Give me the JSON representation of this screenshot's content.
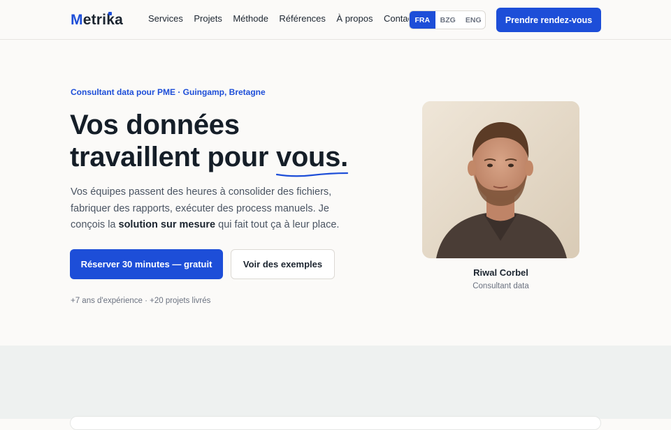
{
  "brand": {
    "name_parts": [
      "M",
      "etri",
      "k",
      "a"
    ]
  },
  "nav": {
    "items": [
      "Services",
      "Projets",
      "Méthode",
      "Références",
      "À propos",
      "Contact"
    ]
  },
  "languages": {
    "options": [
      "FRA",
      "BZG",
      "ENG"
    ],
    "selected": "FRA"
  },
  "header": {
    "cta_label": "Prendre rendez-vous"
  },
  "hero": {
    "eyebrow": "Consultant data pour PME · Guingamp, Bretagne",
    "headline_line1": "Vos données",
    "headline_line2_start": "travaillent pour ",
    "headline_highlight": "vous.",
    "description_part1": "Vos équipes passent des heures à consolider des fichiers, fabriquer des rapports, exécuter des process manuels. Je conçois la ",
    "description_bold": "solution sur mesure",
    "description_part2": " qui fait tout ça à leur place.",
    "primary_cta": "Réserver 30 minutes — gratuit",
    "secondary_cta": "Voir des exemples",
    "stats": "+7 ans d'expérience · +20 projets livrés"
  },
  "profile": {
    "name": "Riwal Corbel",
    "role": "Consultant data"
  },
  "colors": {
    "accent": "#1d4ed8",
    "background": "#fbfaf8",
    "band": "#eef1f0"
  }
}
